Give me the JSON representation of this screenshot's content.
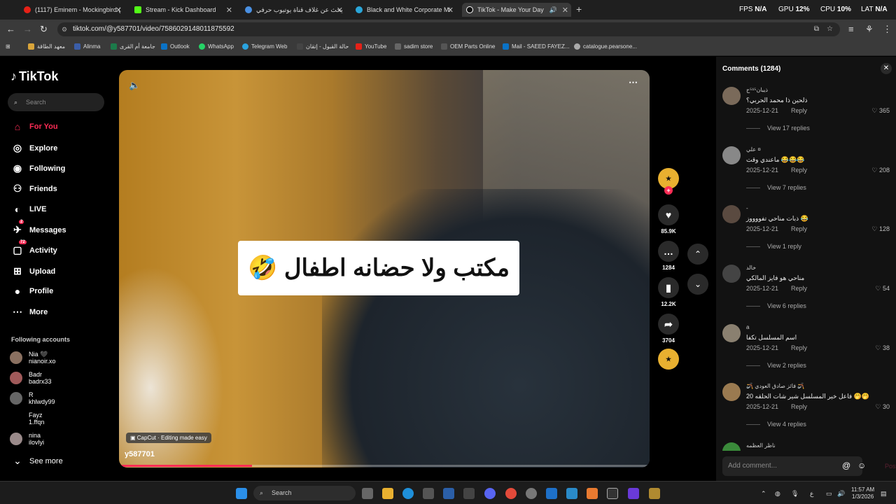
{
  "browser": {
    "tabs": [
      {
        "title": "(1117) Eminem - Mockingbird (",
        "color": "#e62117"
      },
      {
        "title": "Stream - Kick Dashboard",
        "color": "#53fc18"
      },
      {
        "title": "يحث عن غلاف قناة يوتيوب حرفي",
        "color": "#4a90e2"
      },
      {
        "title": "Black and White Corporate Mi",
        "color": "#2aa6d9"
      },
      {
        "title": "TikTok - Make Your Day",
        "color": "#000000"
      }
    ],
    "perf": {
      "fps_label": "FPS",
      "fps": "N/A",
      "gpu_label": "GPU",
      "gpu": "12%",
      "cpu_label": "CPU",
      "cpu": "10%",
      "lat_label": "LAT",
      "lat": "N/A"
    },
    "url": "tiktok.com/@y587701/video/7586029148011875592",
    "bookmarks": [
      "معهد الطاقة",
      "Alinma",
      "جامعة أم القرى",
      "Outlook",
      "WhatsApp",
      "Telegram Web",
      "حالة القبول - إتقان",
      "YouTube",
      "sadim store",
      "OEM Parts Online",
      "Mail - SAEED FAYEZ...",
      "catalogue.pearsone..."
    ]
  },
  "sidebar": {
    "logo": "TikTok",
    "search_placeholder": "Search",
    "nav": [
      {
        "label": "For You",
        "icon": "home-icon"
      },
      {
        "label": "Explore",
        "icon": "compass-icon"
      },
      {
        "label": "Following",
        "icon": "following-icon"
      },
      {
        "label": "Friends",
        "icon": "friends-icon"
      },
      {
        "label": "LIVE",
        "icon": "live-icon"
      },
      {
        "label": "Messages",
        "icon": "messages-icon",
        "badge": "2"
      },
      {
        "label": "Activity",
        "icon": "activity-icon",
        "badge": "72"
      },
      {
        "label": "Upload",
        "icon": "upload-icon"
      },
      {
        "label": "Profile",
        "icon": "profile-icon"
      },
      {
        "label": "More",
        "icon": "more-icon"
      }
    ],
    "following_title": "Following accounts",
    "accounts": [
      {
        "name": "Nia 🖤",
        "handle": "nianoir.xo"
      },
      {
        "name": "Badr",
        "handle": "badrx33"
      },
      {
        "name": "R",
        "handle": "khlwdy99"
      },
      {
        "name": "Fayz",
        "handle": "1.ffqn"
      },
      {
        "name": "nina",
        "handle": "ilovlyi"
      }
    ],
    "see_more": "See more"
  },
  "video": {
    "caption": "مكتب ولا حضانه اطفال 🤣",
    "capcut": "CapCut · Editing made easy",
    "username": "y587701",
    "progress": 0.25
  },
  "actions": {
    "likes": "85.9K",
    "comments": "1284",
    "saves": "12.2K",
    "shares": "3704"
  },
  "comments_panel": {
    "title": "Comments (1284)",
    "reply_label": "Reply",
    "items": [
      {
        "user": "ذيبان⁵¹⁵ح",
        "text": "ذلحين ذا محمد الحربي؟",
        "date": "2025-12-21",
        "likes": "365",
        "replies": "View 17 replies"
      },
      {
        "user": "علي ¤",
        "text": "ماعندي وقت 😂😂😂",
        "date": "2025-12-21",
        "likes": "208",
        "replies": "View 7 replies"
      },
      {
        "user": "-",
        "text": "ذبات مناحي تفووووز 😂",
        "date": "2025-12-21",
        "likes": "128",
        "replies": "View 1 reply"
      },
      {
        "user": "خالد",
        "text": "مناحي هو فايز المالكي",
        "date": "2025-12-21",
        "likes": "54",
        "replies": "View 6 replies"
      },
      {
        "user": "a",
        "text": "اسم المسلسل تكفا",
        "date": "2025-12-21",
        "likes": "38",
        "replies": "View 2 replies"
      },
      {
        "user": "🪃 فائز صادق العودي 🪃",
        "text": "فاعل خير المسلسل شير شات الحلقه 20 🤭🤭",
        "date": "2025-12-21",
        "likes": "30",
        "replies": "View 4 replies"
      },
      {
        "user": "ناظر العظمه",
        "text": "",
        "date": "",
        "likes": "",
        "replies": ""
      }
    ],
    "add_placeholder": "Add comment...",
    "post": "Post"
  },
  "taskbar": {
    "search": "Search",
    "time": "11:57 AM",
    "date": "1/3/2026",
    "lang": "ع"
  }
}
